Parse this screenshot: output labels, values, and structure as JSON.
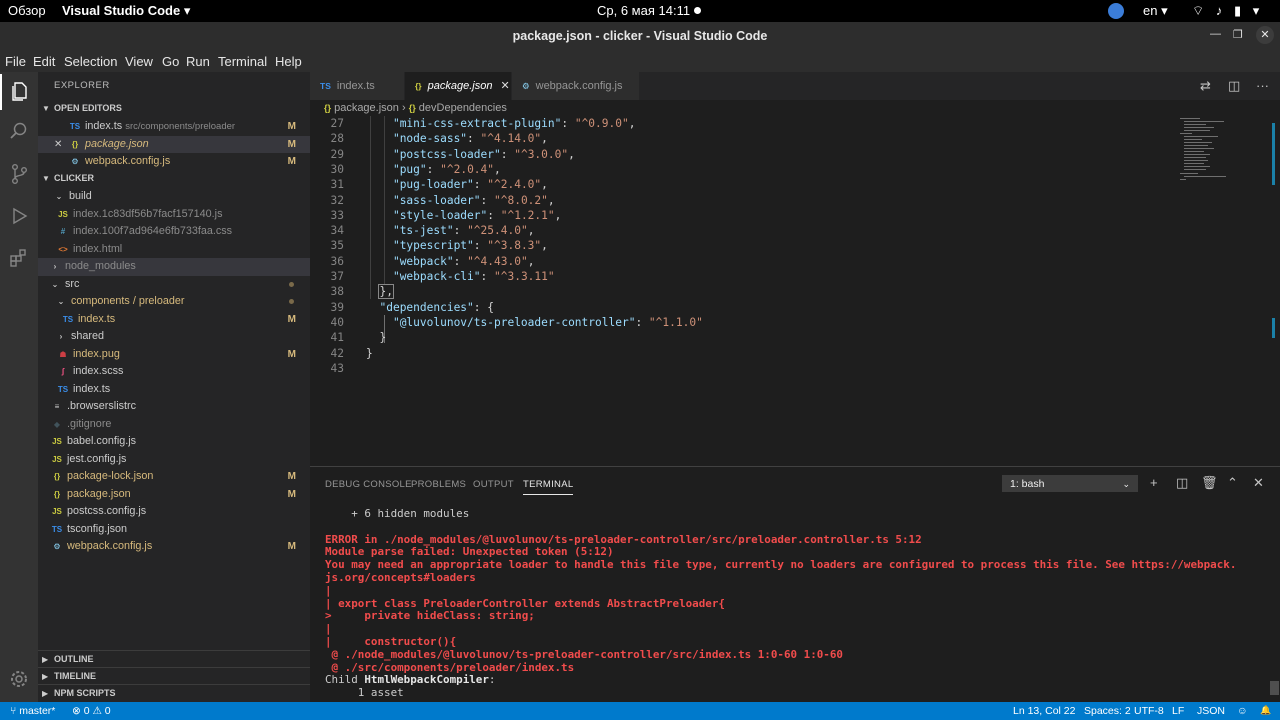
{
  "gnome": {
    "activities": "Обзор",
    "app_menu": "Visual Studio Code ▾",
    "clock": "Ср, 6 мая  14:11",
    "lang": "en ▾",
    "tray": "⌔ ♪ ▮ ▾"
  },
  "window": {
    "title": "package.json - clicker - Visual Studio Code",
    "minimize": "—",
    "maximize": "❐",
    "close": "✕"
  },
  "menu": [
    "File",
    "Edit",
    "Selection",
    "View",
    "Go",
    "Run",
    "Terminal",
    "Help"
  ],
  "activity_icons": [
    "explorer-icon",
    "search-icon",
    "source-control-icon",
    "run-debug-icon",
    "extensions-icon",
    "settings-gear-icon"
  ],
  "sidebar": {
    "title": "EXPLORER",
    "open_editors_label": "OPEN EDITORS",
    "open_editors": [
      {
        "icon": "TS",
        "name": "index.ts",
        "desc": "src/components/preloader",
        "badge": "M"
      },
      {
        "icon": "{}",
        "name": "package.json",
        "desc": "",
        "badge": "M",
        "close": "✕"
      },
      {
        "icon": "⚙",
        "name": "webpack.config.js",
        "desc": "",
        "badge": "M"
      }
    ],
    "folder_label": "CLICKER",
    "tree": [
      {
        "name": "build",
        "chev": "⌄"
      },
      {
        "icon": "JS",
        "name": "index.1c83df56b7facf157140.js"
      },
      {
        "icon": "#",
        "name": "index.100f7ad964e6fb733faa.css"
      },
      {
        "icon": "<>",
        "name": "index.html"
      },
      {
        "name": "node_modules",
        "chev": "›"
      },
      {
        "name": "src",
        "chev": "⌄"
      },
      {
        "name": "components / preloader",
        "chev": "⌄"
      },
      {
        "icon": "TS",
        "name": "index.ts",
        "badge": "M"
      },
      {
        "name": "shared",
        "chev": "›"
      },
      {
        "icon": "☗",
        "name": "index.pug",
        "badge": "M"
      },
      {
        "icon": "ʃ",
        "name": "index.scss"
      },
      {
        "icon": "TS",
        "name": "index.ts"
      },
      {
        "icon": "≡",
        "name": ".browserslistrc"
      },
      {
        "icon": "◆",
        "name": ".gitignore"
      },
      {
        "icon": "JS",
        "name": "babel.config.js"
      },
      {
        "icon": "JS",
        "name": "jest.config.js"
      },
      {
        "icon": "{}",
        "name": "package-lock.json",
        "badge": "M"
      },
      {
        "icon": "{}",
        "name": "package.json",
        "badge": "M"
      },
      {
        "icon": "JS",
        "name": "postcss.config.js"
      },
      {
        "icon": "TS",
        "name": "tsconfig.json"
      },
      {
        "icon": "⚙",
        "name": "webpack.config.js",
        "badge": "M"
      }
    ],
    "outline_label": "OUTLINE",
    "timeline_label": "TIMELINE",
    "npm_label": "NPM SCRIPTS"
  },
  "tabs": [
    {
      "icon": "TS",
      "label": "index.ts"
    },
    {
      "icon": "{}",
      "label": "package.json",
      "close": "✕"
    },
    {
      "icon": "⚙",
      "label": "webpack.config.js"
    }
  ],
  "breadcrumb": {
    "file": "package.json",
    "sep": "›",
    "node_icon": "{}",
    "node": "devDependencies"
  },
  "code": [
    {
      "n": "27",
      "key": "\"mini-css-extract-plugin\"",
      "val": "\"^0.9.0\"",
      "end": ","
    },
    {
      "n": "28",
      "key": "\"node-sass\"",
      "val": "\"^4.14.0\"",
      "end": ","
    },
    {
      "n": "29",
      "key": "\"postcss-loader\"",
      "val": "\"^3.0.0\"",
      "end": ","
    },
    {
      "n": "30",
      "key": "\"pug\"",
      "val": "\"^2.0.4\"",
      "end": ","
    },
    {
      "n": "31",
      "key": "\"pug-loader\"",
      "val": "\"^2.4.0\"",
      "end": ","
    },
    {
      "n": "32",
      "key": "\"sass-loader\"",
      "val": "\"^8.0.2\"",
      "end": ","
    },
    {
      "n": "33",
      "key": "\"style-loader\"",
      "val": "\"^1.2.1\"",
      "end": ","
    },
    {
      "n": "34",
      "key": "\"ts-jest\"",
      "val": "\"^25.4.0\"",
      "end": ","
    },
    {
      "n": "35",
      "key": "\"typescript\"",
      "val": "\"^3.8.3\"",
      "end": ","
    },
    {
      "n": "36",
      "key": "\"webpack\"",
      "val": "\"^4.43.0\"",
      "end": ","
    },
    {
      "n": "37",
      "key": "\"webpack-cli\"",
      "val": "\"^3.3.11\"",
      "end": ""
    },
    {
      "n": "38",
      "text": "},"
    },
    {
      "n": "39",
      "key": "\"dependencies\"",
      "val": "{",
      "end": ""
    },
    {
      "n": "40",
      "key": "\"@luvolunov/ts-preloader-controller\"",
      "val": "\"^1.1.0\"",
      "end": ""
    },
    {
      "n": "41",
      "text": "}"
    },
    {
      "n": "42",
      "text": "}"
    },
    {
      "n": "43",
      "text": ""
    }
  ],
  "panel": {
    "tabs": [
      "DEBUG CONSOLE",
      "PROBLEMS",
      "OUTPUT",
      "TERMINAL"
    ],
    "terminal_select": "1: bash",
    "terminal_lines": [
      {
        "t": "    + 6 hidden modules",
        "c": "plain"
      },
      {
        "t": "",
        "c": "plain"
      },
      {
        "t": "ERROR in ./node_modules/@luvolunov/ts-preloader-controller/src/preloader.controller.ts 5:12",
        "c": "err"
      },
      {
        "t": "Module parse failed: Unexpected token (5:12)",
        "c": "err"
      },
      {
        "t": "You may need an appropriate loader to handle this file type, currently no loaders are configured to process this file. See https://webpack.",
        "c": "err"
      },
      {
        "t": "js.org/concepts#loaders",
        "c": "err"
      },
      {
        "t": "|",
        "c": "err"
      },
      {
        "t": "| export class PreloaderController extends AbstractPreloader{",
        "c": "err"
      },
      {
        "t": ">     private hideClass: string;",
        "c": "err"
      },
      {
        "t": "|",
        "c": "err"
      },
      {
        "t": "|     constructor(){",
        "c": "err"
      },
      {
        "t": " @ ./node_modules/@luvolunov/ts-preloader-controller/src/index.ts 1:0-60 1:0-60",
        "c": "err"
      },
      {
        "t": " @ ./src/components/preloader/index.ts",
        "c": "err"
      },
      {
        "t": "Child ",
        "bold": "HtmlWebpackCompiler",
        "after": ":",
        "c": "child"
      },
      {
        "t": "     1 asset",
        "c": "plain"
      }
    ]
  },
  "status": {
    "branch": "⑂ master*",
    "problems": "⊗ 0 ⚠ 0",
    "position": "Ln 13, Col 22",
    "spaces": "Spaces: 2",
    "encoding": "UTF-8",
    "eol": "LF",
    "language": "JSON",
    "feedback": "☺",
    "bell": "🔔"
  }
}
